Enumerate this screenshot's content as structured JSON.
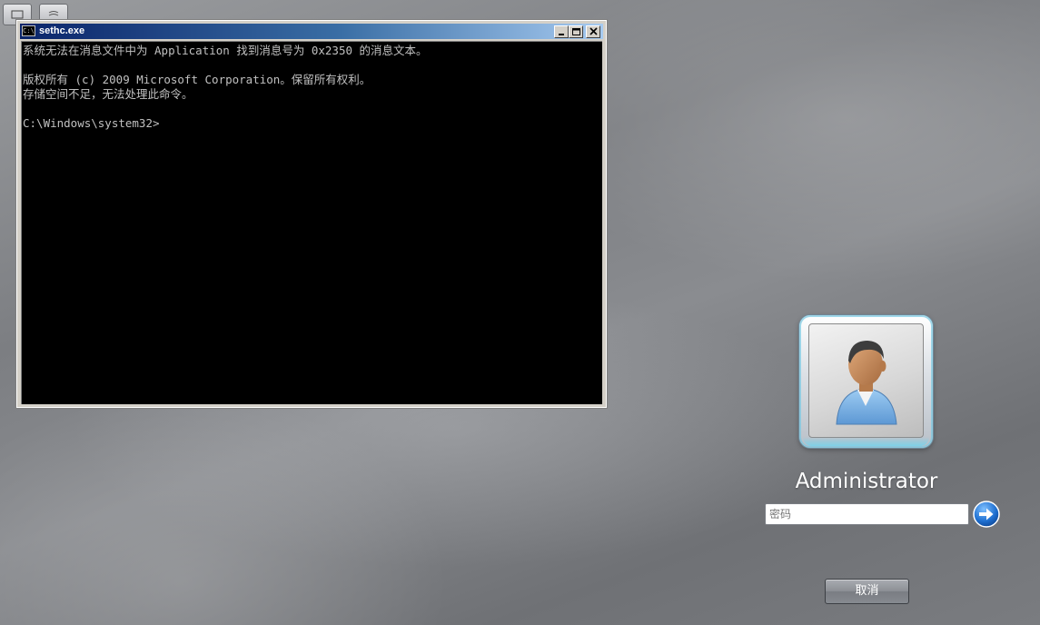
{
  "console": {
    "title": "sethc.exe",
    "icon_text": "C:\\",
    "lines": [
      "系统无法在消息文件中为 Application 找到消息号为 0x2350 的消息文本。",
      "",
      "版权所有 (c) 2009 Microsoft Corporation。保留所有权利。",
      "存储空间不足，无法处理此命令。",
      "",
      "C:\\Windows\\system32>"
    ]
  },
  "login": {
    "username": "Administrator",
    "password_placeholder": "密码",
    "password_value": "",
    "cancel_label": "取消"
  },
  "icons": {
    "title": "console-icon",
    "minimize": "minimize-icon",
    "maximize": "maximize-icon",
    "close": "close-icon",
    "submit": "arrow-right-icon",
    "avatar": "user-avatar-icon",
    "accessibility": "ease-of-access-icon"
  },
  "colors": {
    "console_bg": "#000000",
    "console_text": "#c0c0c0",
    "title_bar_start": "#0a246a",
    "title_bar_end": "#a6caf0",
    "arrow_blue": "#1e6fd0"
  }
}
